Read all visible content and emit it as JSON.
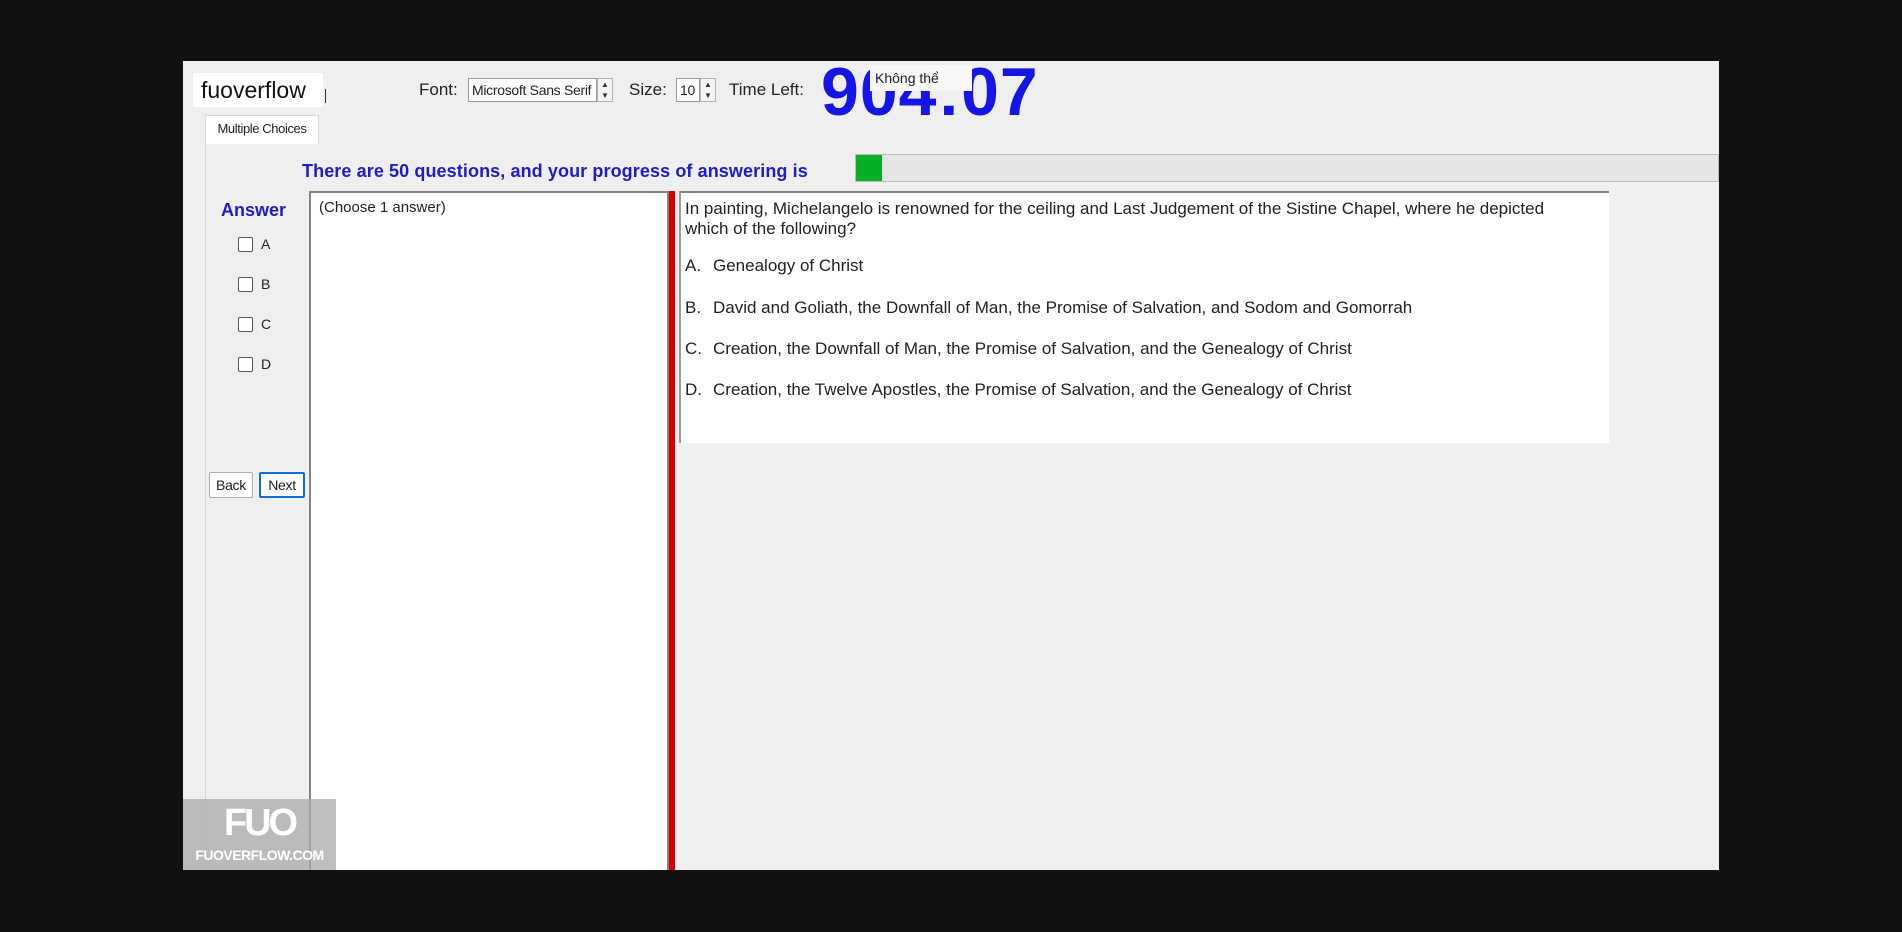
{
  "app": {
    "brand": "fuoverflow"
  },
  "toolbar": {
    "font_label": "Font:",
    "font_value": "Microsoft Sans Serif",
    "size_label": "Size:",
    "size_value": "10",
    "time_label": "Time Left:",
    "time_value": "904:07",
    "tooltip": "Không thể"
  },
  "tabs": [
    {
      "label": "Multiple Choices"
    }
  ],
  "progress": {
    "text": "There are 50 questions, and your progress of answering is",
    "value_fraction": 0.03
  },
  "answer": {
    "title": "Answer",
    "options": [
      "A",
      "B",
      "C",
      "D"
    ],
    "hint": "(Choose 1 answer)"
  },
  "nav": {
    "back": "Back",
    "next": "Next"
  },
  "question": {
    "text": "In painting, Michelangelo is renowned for the ceiling and Last Judgement of the Sistine Chapel, where he depicted which of the following?",
    "choices": [
      {
        "key": "A.",
        "text": "Genealogy of Christ"
      },
      {
        "key": "B.",
        "text": "David and Goliath, the Downfall of Man, the Promise of Salvation, and Sodom and Gomorrah"
      },
      {
        "key": "C.",
        "text": "Creation, the Downfall of Man, the Promise of Salvation, and the Genealogy of Christ"
      },
      {
        "key": "D.",
        "text": "Creation, the Twelve Apostles, the Promise of Salvation, and the Genealogy of Christ"
      }
    ]
  },
  "watermark": {
    "logo": "FUO",
    "site": "FUOVERFLOW.COM"
  },
  "colors": {
    "accent_blue": "#1c1cc8",
    "timer_blue": "#1515e6",
    "progress_green": "#06b025",
    "splitter_red": "#d40000"
  }
}
